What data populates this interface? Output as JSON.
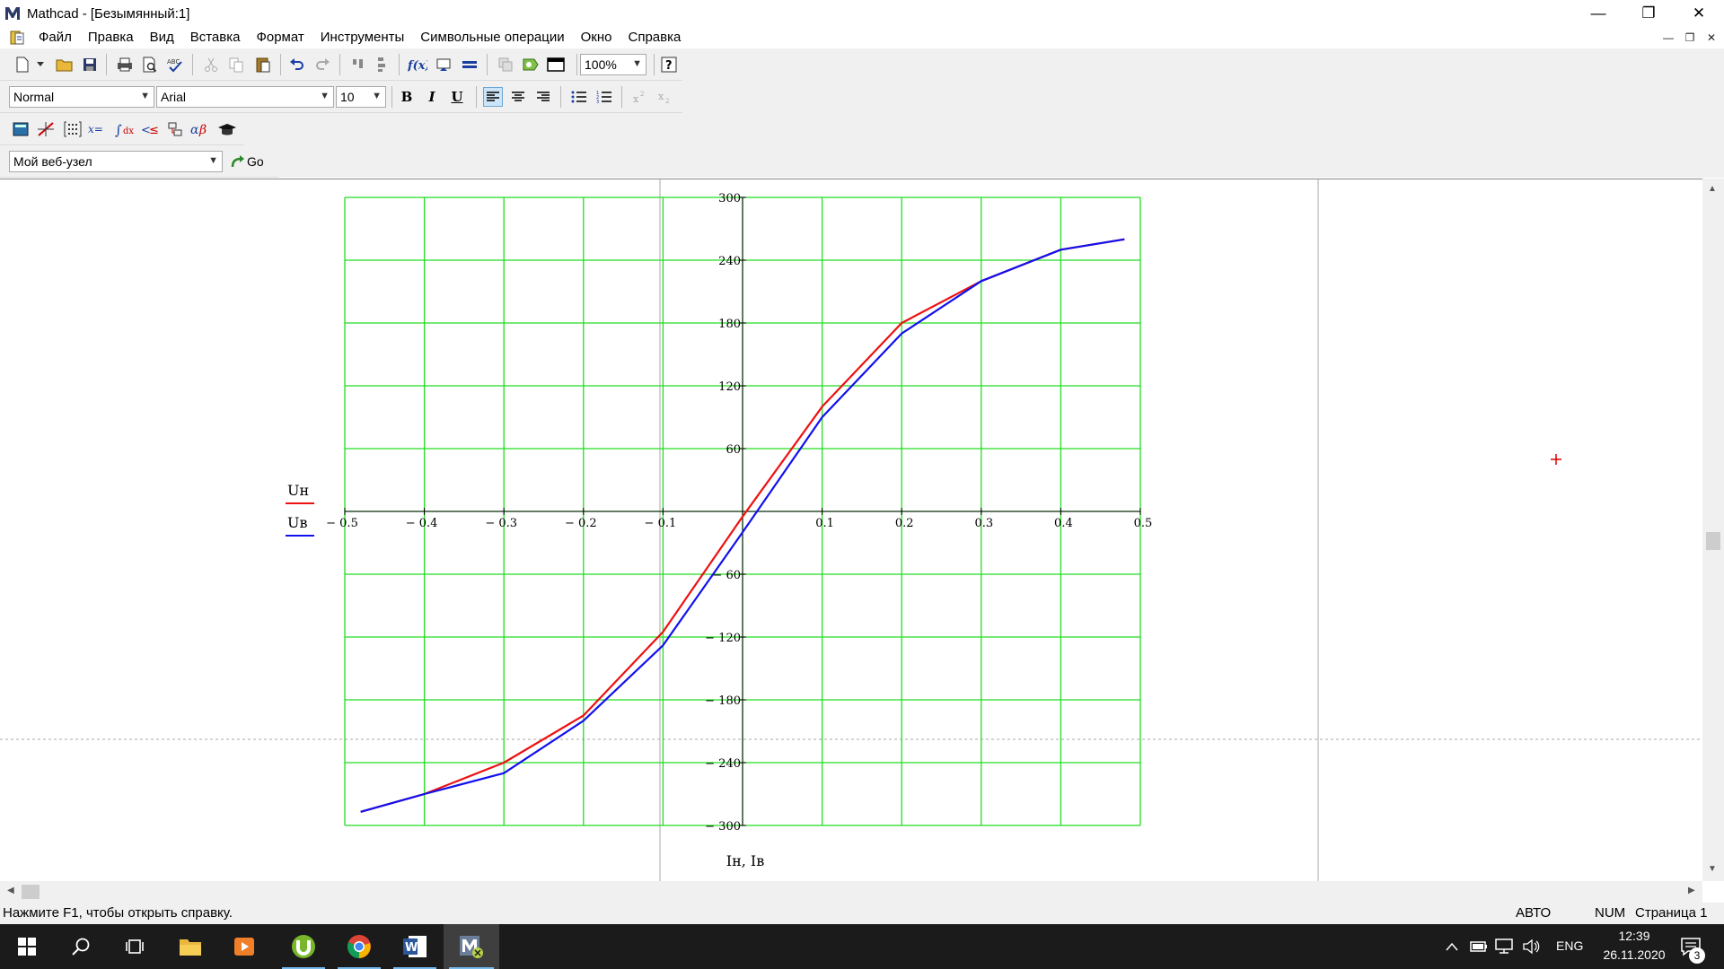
{
  "window": {
    "title": "Mathcad - [Безымянный:1]",
    "minimize_glyph": "—",
    "restore_glyph": "❐",
    "close_glyph": "✕"
  },
  "menu": {
    "items": [
      "Файл",
      "Правка",
      "Вид",
      "Вставка",
      "Формат",
      "Инструменты",
      "Символьные операции",
      "Окно",
      "Справка"
    ]
  },
  "toolbar": {
    "zoom": "100%",
    "style": "Normal",
    "font": "Arial",
    "font_size": "10",
    "bold_label": "B",
    "italic_label": "I",
    "underline_label": "U",
    "web_location": "Мой веб-узел",
    "go_label": "Go"
  },
  "chart_data": {
    "type": "line",
    "xlim": [
      -0.5,
      0.5
    ],
    "ylim": [
      -300,
      300
    ],
    "x_ticks": [
      -0.5,
      -0.4,
      -0.3,
      -0.2,
      -0.1,
      0.1,
      0.2,
      0.3,
      0.4,
      0.5
    ],
    "y_ticks": [
      -300,
      -240,
      -180,
      -120,
      -60,
      60,
      120,
      180,
      240,
      300
    ],
    "x_tick_labels": [
      "− 0.5",
      "− 0.4",
      "− 0.3",
      "− 0.2",
      "− 0.1",
      "0.1",
      "0.2",
      "0.3",
      "0.4",
      "0.5"
    ],
    "y_tick_labels": [
      "− 300",
      "− 240",
      "− 180",
      "− 120",
      "− 60",
      "60",
      "120",
      "180",
      "240",
      "300"
    ],
    "grid": true,
    "xlabel": "Iн, Iв",
    "ylabel_series": [
      "Uн",
      "Uв"
    ],
    "series": [
      {
        "name": "Uн",
        "color": "#ee1111",
        "x": [
          -0.48,
          -0.4,
          -0.3,
          -0.2,
          -0.1,
          0.0,
          0.1,
          0.2,
          0.3,
          0.4,
          0.48
        ],
        "y": [
          -287,
          -270,
          -240,
          -195,
          -115,
          -5,
          100,
          180,
          220,
          250,
          260
        ]
      },
      {
        "name": "Uв",
        "color": "#1111ee",
        "x": [
          -0.48,
          -0.4,
          -0.3,
          -0.2,
          -0.1,
          0.0,
          0.1,
          0.2,
          0.3,
          0.4,
          0.48
        ],
        "y": [
          -287,
          -270,
          -250,
          -200,
          -128,
          -20,
          90,
          170,
          220,
          250,
          260
        ]
      }
    ]
  },
  "status": {
    "help": "Нажмите F1, чтобы открыть справку.",
    "mode": "АВТО",
    "num": "NUM",
    "page": "Страница 1"
  },
  "taskbar": {
    "lang": "ENG",
    "time": "12:39",
    "date": "26.11.2020",
    "notifications": "3"
  },
  "colors": {
    "grid": "#22dd22",
    "axes": "#000000",
    "series1": "#ee1111",
    "series2": "#1111ee",
    "cursor": "#dd0000"
  }
}
